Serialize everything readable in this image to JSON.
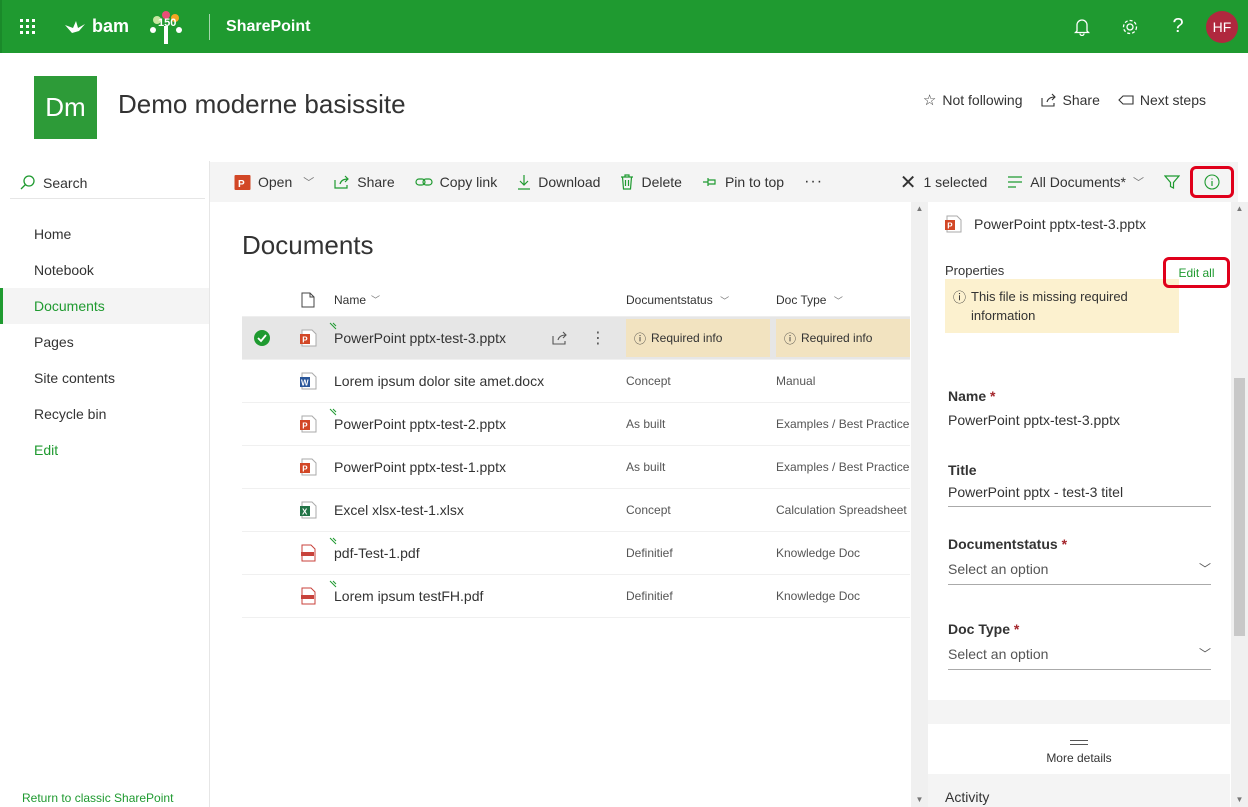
{
  "suite": {
    "logo_text": "bam",
    "badge_text": "150",
    "app_name": "SharePoint",
    "avatar_initials": "HF"
  },
  "site": {
    "logo_initials": "Dm",
    "title": "Demo moderne basissite",
    "actions": [
      "Not following",
      "Share",
      "Next steps"
    ]
  },
  "leftnav": {
    "search_label": "Search",
    "items": [
      {
        "label": "Home"
      },
      {
        "label": "Notebook"
      },
      {
        "label": "Documents"
      },
      {
        "label": "Pages"
      },
      {
        "label": "Site contents"
      },
      {
        "label": "Recycle bin"
      },
      {
        "label": "Edit"
      }
    ],
    "return_link": "Return to classic SharePoint"
  },
  "commandbar": {
    "open": "Open",
    "share": "Share",
    "copy_link": "Copy link",
    "download": "Download",
    "delete": "Delete",
    "pin": "Pin to top",
    "more": "···",
    "selected": "1 selected",
    "view": "All Documents*"
  },
  "library": {
    "title": "Documents",
    "columns": {
      "name": "Name",
      "status": "Documentstatus",
      "type": "Doc Type"
    },
    "rows": [
      {
        "name": "PowerPoint pptx-test-3.pptx",
        "status": "Required info",
        "type": "Required info",
        "icon": "powerpoint-icon"
      },
      {
        "name": "Lorem ipsum dolor site amet.docx",
        "status": "Concept",
        "type": "Manual",
        "icon": "word-icon"
      },
      {
        "name": "PowerPoint pptx-test-2.pptx",
        "status": "As built",
        "type": "Examples / Best Practice",
        "icon": "powerpoint-icon"
      },
      {
        "name": "PowerPoint pptx-test-1.pptx",
        "status": "As built",
        "type": "Examples / Best Practice",
        "icon": "powerpoint-icon"
      },
      {
        "name": "Excel xlsx-test-1.xlsx",
        "status": "Concept",
        "type": "Calculation Spreadsheet",
        "icon": "excel-icon"
      },
      {
        "name": "pdf-Test-1.pdf",
        "status": "Definitief",
        "type": "Knowledge Doc",
        "icon": "pdf-icon"
      },
      {
        "name": "Lorem ipsum testFH.pdf",
        "status": "Definitief",
        "type": "Knowledge Doc",
        "icon": "pdf-icon"
      }
    ]
  },
  "details": {
    "file_name": "PowerPoint pptx-test-3.pptx",
    "properties_label": "Properties",
    "edit_all": "Edit all",
    "warning": "This file is missing required information",
    "name_label": "Name",
    "name_value": "PowerPoint pptx-test-3.pptx",
    "title_label": "Title",
    "title_value": "PowerPoint pptx - test-3 titel",
    "status_label": "Documentstatus",
    "status_placeholder": "Select an option",
    "doctype_label": "Doc Type",
    "doctype_placeholder": "Select an option",
    "more_details": "More details",
    "activity": "Activity"
  },
  "colors": {
    "accent": "#1f9a30",
    "highlight_box": "#e0001b",
    "required_bg": "#f2e3c0"
  }
}
